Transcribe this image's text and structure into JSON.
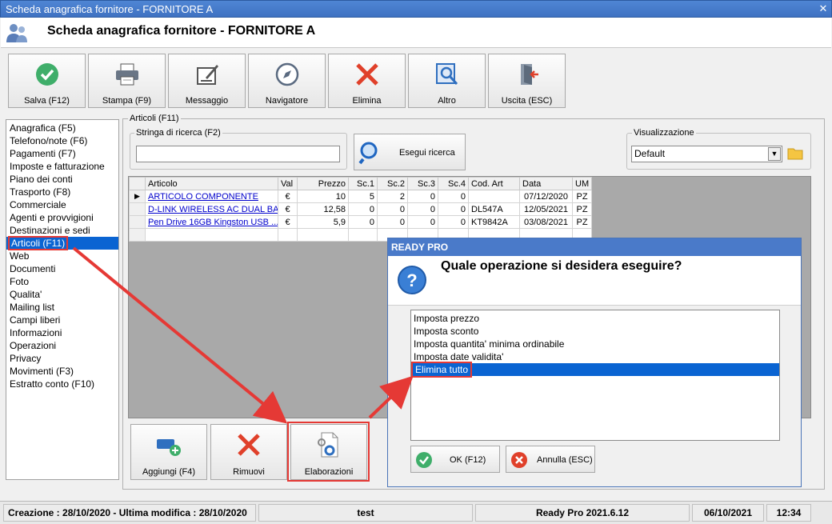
{
  "window": {
    "title": "Scheda anagrafica fornitore - FORNITORE A",
    "close": "✕"
  },
  "header": {
    "title": "Scheda anagrafica fornitore - FORNITORE A"
  },
  "toolbar": [
    {
      "label": "Salva (F12)",
      "icon": "check-circle-icon"
    },
    {
      "label": "Stampa (F9)",
      "icon": "printer-icon"
    },
    {
      "label": "Messaggio",
      "icon": "message-icon"
    },
    {
      "label": "Navigatore",
      "icon": "compass-icon"
    },
    {
      "label": "Elimina",
      "icon": "delete-x-icon"
    },
    {
      "label": "Altro",
      "icon": "magnifier-icon"
    },
    {
      "label": "Uscita (ESC)",
      "icon": "exit-door-icon"
    }
  ],
  "nav": {
    "items": [
      "Anagrafica (F5)",
      "Telefono/note (F6)",
      "Pagamenti (F7)",
      "Imposte e fatturazione",
      "Piano dei conti",
      "Trasporto (F8)",
      "Commerciale",
      "Agenti e provvigioni",
      "Destinazioni e sedi",
      "Articoli (F11)",
      "Web",
      "Documenti",
      "Foto",
      "Qualita'",
      "Mailing list",
      "Campi liberi",
      "Informazioni",
      "Operazioni",
      "Privacy",
      "Movimenti (F3)",
      "Estratto conto (F10)"
    ],
    "selected_index": 9
  },
  "articoli": {
    "group_label": "Articoli (F11)",
    "search_label": "Stringa di ricerca (F2)",
    "search_value": "",
    "search_button": "Esegui ricerca",
    "vis_label": "Visualizzazione",
    "vis_value": "Default"
  },
  "grid": {
    "columns": [
      "Articolo",
      "Val",
      "Prezzo",
      "Sc.1",
      "Sc.2",
      "Sc.3",
      "Sc.4",
      "Cod. Art",
      "Data",
      "UM"
    ],
    "rows": [
      [
        "ARTICOLO COMPONENTE",
        "€",
        "10",
        "5",
        "2",
        "0",
        "0",
        "",
        "07/12/2020",
        "PZ"
      ],
      [
        "D-LINK WIRELESS AC DUAL BA...",
        "€",
        "12,58",
        "0",
        "0",
        "0",
        "0",
        "DL547A",
        "12/05/2021",
        "PZ"
      ],
      [
        "Pen Drive 16GB  Kingston  USB ...",
        "€",
        "5,9",
        "0",
        "0",
        "0",
        "0",
        "KT9842A",
        "03/08/2021",
        "PZ"
      ]
    ],
    "current_row_marker": "▶"
  },
  "bottom_buttons": [
    {
      "label": "Aggiungi (F4)",
      "icon": "add-item-icon"
    },
    {
      "label": "Rimuovi",
      "icon": "remove-x-icon"
    },
    {
      "label": "Elaborazioni",
      "icon": "document-gears-icon"
    }
  ],
  "dialog": {
    "title": "READY PRO",
    "question": "Quale operazione si desidera eseguire?",
    "options": [
      "Imposta prezzo",
      "Imposta sconto",
      "Imposta quantita' minima ordinabile",
      "Imposta date validita'",
      "Elimina tutto"
    ],
    "selected_index": 4,
    "ok_label": "OK (F12)",
    "cancel_label": "Annulla (ESC)"
  },
  "status": {
    "dates": "Creazione : 28/10/2020 - Ultima modifica : 28/10/2020",
    "user": "test",
    "version": "Ready Pro 2021.6.12",
    "date": "06/10/2021",
    "time": "12:34"
  },
  "colors": {
    "accent": "#0a64d2",
    "annotation": "#e53935",
    "title_bar": "#4a7ac9"
  }
}
